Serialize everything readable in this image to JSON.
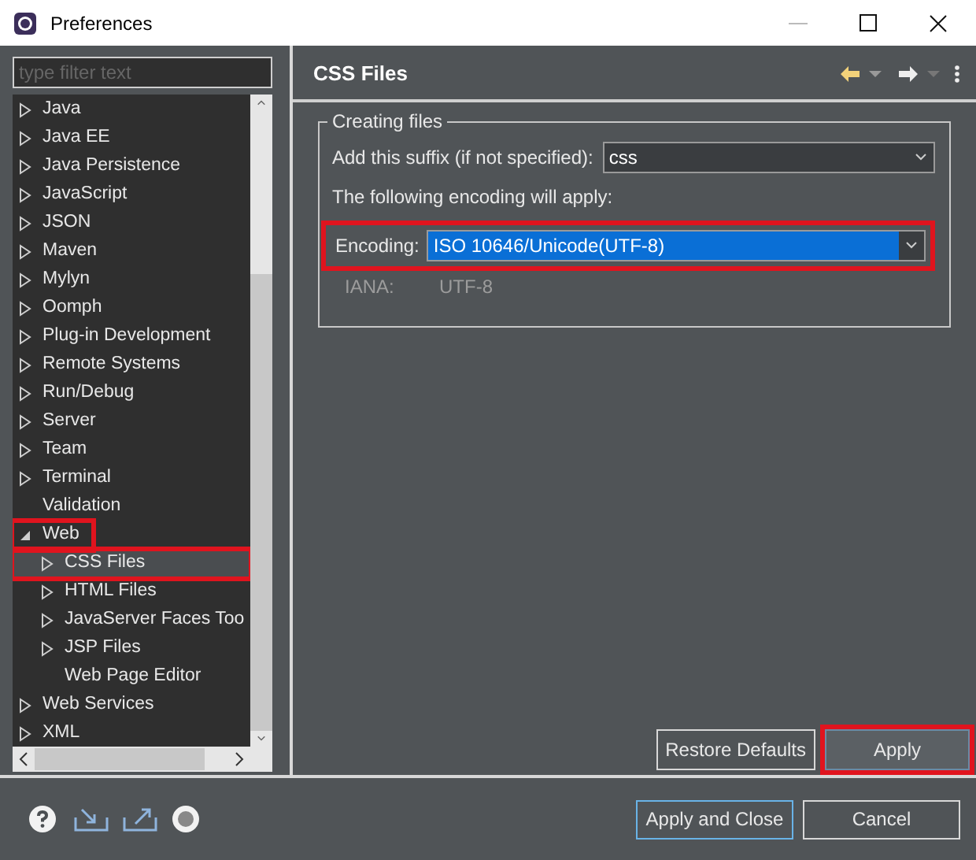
{
  "window": {
    "title": "Preferences"
  },
  "filter": {
    "placeholder": "type filter text"
  },
  "tree": [
    {
      "label": "Java",
      "kind": "branch",
      "expanded": false,
      "selected": false,
      "highlighted": false
    },
    {
      "label": "Java EE",
      "kind": "branch",
      "expanded": false,
      "selected": false,
      "highlighted": false
    },
    {
      "label": "Java Persistence",
      "kind": "branch",
      "expanded": false,
      "selected": false,
      "highlighted": false
    },
    {
      "label": "JavaScript",
      "kind": "branch",
      "expanded": false,
      "selected": false,
      "highlighted": false
    },
    {
      "label": "JSON",
      "kind": "branch",
      "expanded": false,
      "selected": false,
      "highlighted": false
    },
    {
      "label": "Maven",
      "kind": "branch",
      "expanded": false,
      "selected": false,
      "highlighted": false
    },
    {
      "label": "Mylyn",
      "kind": "branch",
      "expanded": false,
      "selected": false,
      "highlighted": false
    },
    {
      "label": "Oomph",
      "kind": "branch",
      "expanded": false,
      "selected": false,
      "highlighted": false
    },
    {
      "label": "Plug-in Development",
      "kind": "branch",
      "expanded": false,
      "selected": false,
      "highlighted": false
    },
    {
      "label": "Remote Systems",
      "kind": "branch",
      "expanded": false,
      "selected": false,
      "highlighted": false
    },
    {
      "label": "Run/Debug",
      "kind": "branch",
      "expanded": false,
      "selected": false,
      "highlighted": false
    },
    {
      "label": "Server",
      "kind": "branch",
      "expanded": false,
      "selected": false,
      "highlighted": false
    },
    {
      "label": "Team",
      "kind": "branch",
      "expanded": false,
      "selected": false,
      "highlighted": false
    },
    {
      "label": "Terminal",
      "kind": "branch",
      "expanded": false,
      "selected": false,
      "highlighted": false
    },
    {
      "label": "Validation",
      "kind": "leaf",
      "selected": false,
      "highlighted": false
    },
    {
      "label": "Web",
      "kind": "branch",
      "expanded": true,
      "selected": false,
      "highlighted": true,
      "children": [
        {
          "label": "CSS Files",
          "kind": "branch",
          "expanded": false,
          "selected": true,
          "highlighted": true
        },
        {
          "label": "HTML Files",
          "kind": "branch",
          "expanded": false,
          "selected": false,
          "highlighted": false
        },
        {
          "label": "JavaServer Faces Too",
          "kind": "branch",
          "expanded": false,
          "selected": false,
          "highlighted": false
        },
        {
          "label": "JSP Files",
          "kind": "branch",
          "expanded": false,
          "selected": false,
          "highlighted": false
        },
        {
          "label": "Web Page Editor",
          "kind": "leaf",
          "selected": false,
          "highlighted": false
        }
      ]
    },
    {
      "label": "Web Services",
      "kind": "branch",
      "expanded": false,
      "selected": false,
      "highlighted": false
    },
    {
      "label": "XML",
      "kind": "branch",
      "expanded": false,
      "selected": false,
      "highlighted": false
    }
  ],
  "page": {
    "title": "CSS Files",
    "group": {
      "title": "Creating files",
      "suffix": {
        "label": "Add this suffix (if not specified):",
        "value": "css"
      },
      "note": "The following encoding will apply:",
      "encoding": {
        "label": "Encoding:",
        "value": "ISO 10646/Unicode(UTF-8)",
        "highlighted": true
      },
      "iana": {
        "label": "IANA:",
        "value": "UTF-8"
      }
    },
    "buttons": [
      {
        "label": "Restore Defaults",
        "highlighted": false
      },
      {
        "label": "Apply",
        "highlighted": true
      }
    ]
  },
  "footer_buttons": [
    "Apply and Close",
    "Cancel"
  ]
}
